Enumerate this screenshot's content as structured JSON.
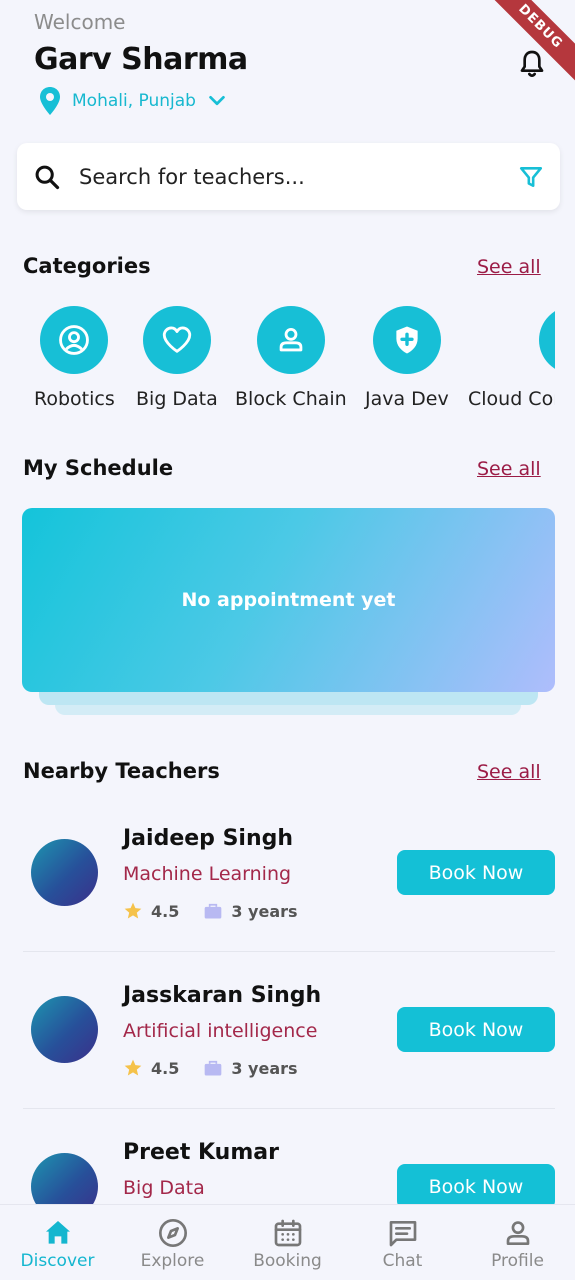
{
  "header": {
    "welcome": "Welcome",
    "user_name": "Garv Sharma",
    "location": "Mohali, Punjab",
    "debug_label": "DEBUG"
  },
  "search": {
    "placeholder": "Search for teachers..."
  },
  "categories": {
    "title": "Categories",
    "see_all": "See all",
    "items": [
      {
        "label": "Robotics",
        "icon": "person-circle-icon"
      },
      {
        "label": "Big Data",
        "icon": "heart-icon"
      },
      {
        "label": "Block Chain",
        "icon": "person-icon"
      },
      {
        "label": "Java Dev",
        "icon": "shield-plus-icon"
      },
      {
        "label": "Cloud Computing",
        "icon": "medical-kit-icon"
      }
    ]
  },
  "schedule": {
    "title": "My Schedule",
    "see_all": "See all",
    "empty_text": "No appointment yet"
  },
  "nearby": {
    "title": "Nearby Teachers",
    "see_all": "See all",
    "teachers": [
      {
        "name": "Jaideep Singh",
        "subject": "Machine Learning",
        "rating": "4.5",
        "experience": "3 years",
        "button": "Book Now"
      },
      {
        "name": "Jasskaran Singh",
        "subject": "Artificial intelligence",
        "rating": "4.5",
        "experience": "3 years",
        "button": "Book Now"
      },
      {
        "name": "Preet Kumar",
        "subject": "Big Data",
        "rating": "",
        "experience": "",
        "button": "Book Now"
      }
    ]
  },
  "nav": {
    "items": [
      {
        "label": "Discover",
        "icon": "home-icon",
        "active": true
      },
      {
        "label": "Explore",
        "icon": "compass-icon",
        "active": false
      },
      {
        "label": "Booking",
        "icon": "calendar-icon",
        "active": false
      },
      {
        "label": "Chat",
        "icon": "chat-icon",
        "active": false
      },
      {
        "label": "Profile",
        "icon": "profile-icon",
        "active": false
      }
    ]
  },
  "colors": {
    "accent": "#17bfd6",
    "link": "#9b1c46",
    "subject": "#a3284a",
    "background": "#f4f5fc"
  }
}
